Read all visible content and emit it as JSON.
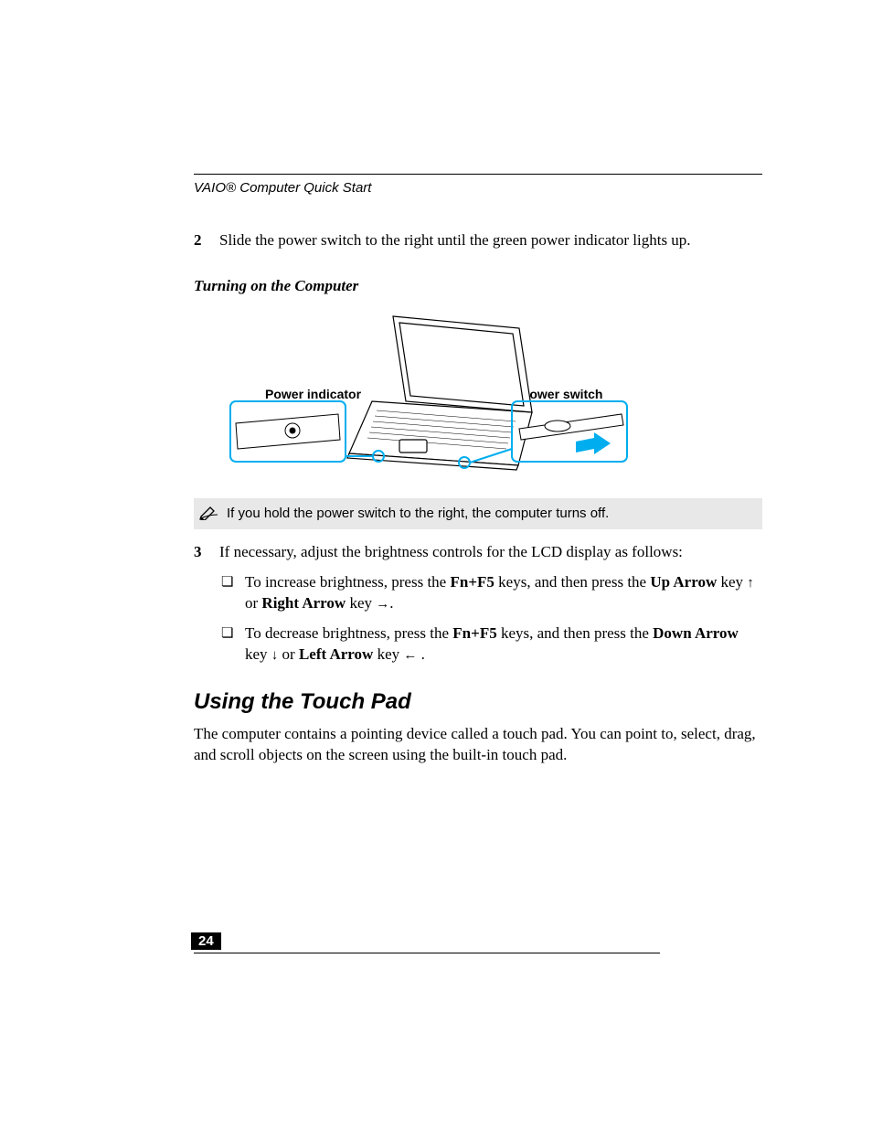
{
  "header": {
    "running": "VAIO® Computer Quick Start"
  },
  "steps": {
    "two": {
      "num": "2",
      "text": "Slide the power switch to the right until the green power indicator lights up."
    },
    "three": {
      "num": "3",
      "text": "If necessary, adjust the brightness controls for the LCD display as follows:"
    }
  },
  "figure": {
    "caption": "Turning on the Computer",
    "label_left": "Power indicator",
    "label_right": "Power switch"
  },
  "note": {
    "text": "If you hold the power switch to the right, the computer turns off."
  },
  "bullets": {
    "inc": {
      "p1": "To increase brightness, press the ",
      "fnf5": "Fn+F5",
      "p2": " keys, and then press the ",
      "up_arrow": "Up Arrow",
      "p3": " key  ",
      "or": " or ",
      "right_arrow": "Right Arrow",
      "p4": " key  ",
      "period": "."
    },
    "dec": {
      "p1": "To decrease brightness, press the ",
      "fnf5": "Fn+F5",
      "p2": " keys, and then press the ",
      "down_arrow": "Down Arrow",
      "p3": " key  ",
      "or": " or ",
      "left_arrow": "Left Arrow",
      "p4": " key ",
      "period": " ."
    }
  },
  "section": {
    "heading": "Using the Touch Pad",
    "para": "The computer contains a pointing device called a touch pad. You can point to, select, drag, and scroll objects on the screen using the built-in touch pad."
  },
  "footer": {
    "page_number": "24"
  }
}
